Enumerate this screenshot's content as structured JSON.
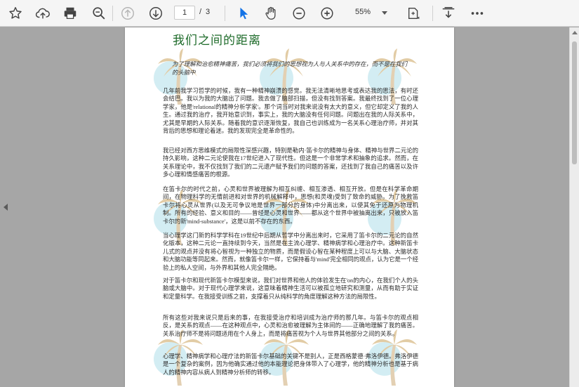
{
  "toolbar": {
    "current_page": "1",
    "page_separator": "/",
    "total_pages": "3",
    "zoom": "55%"
  },
  "document": {
    "title": "我们之间的距离",
    "subtitle": "为了理解和治愈精神痛苦，我们必须将我们的思想视为人与人关系中的存在，而不是在我们的头脑中",
    "paragraphs": [
      "几年前我学习哲学的时候，我有一种精神崩溃的感觉。我无法清晰地思考或表达我的思法，有时还会结巴。我以为我的大脑出了问题。我去做了脑部扫描，但没有找到答案。我最终找到了一位心理学家，他是'relational的精神分析学家'。那个词当时对我来说没有太大的意义，但它却定义了我的人生。通过我的治疗，我开始意识到，事实上，我的大脑没有任何问题。问题出在我的人际关系中，尤其是早期的人际关系。随着我的意识逐渐恢复，我自己也训练成为一名关系心理治疗师，并对其背后的思想和理论着迷。我的发现完全是革命性的。",
      "我已经对西方思维模式的局限性深感兴趣，特别是勒内·笛卡尔的精神与身体、精神与世界二元论的持久影响，这种二元论使我在17世纪进入了现代性。但这是一个非常学术和抽象的追求。然而，在关系理论中，我不仅找到了我们的二元遗产赋予我们的问题的答案，还找到了我自己的痛苦以及许多心理和情感痛苦的根源。",
      "在笛卡尔的时代之前，心灵和世界被理解为相互纠缠、相互渗透、相互开放。但是在科学革命期间，在物理科学的无情前进和对世界的机械解释中，思想(和灵魂)受到了致命的威胁。为了挽救笛卡尔将心灵从世界(以及无可争议地是世界一部分的身体)中分离出来，以使其免于还原为物理机制。所有的经验、意义和目的——曾经是心灵和世界——都从这个世界中被抽离出来，只被放入笛卡尔的新'mind-substance'，这是以前不存在的东西。",
      "当心理学这门新的科学学科在19世纪中后期从哲学中分离出来时，它采用了笛卡尔的二元论的自然化版本，这种二元论一直持续到今天，当然是在主流心理学、精神病学和心理治疗中。这种新笛卡儿式的观点并没有将心智视为一种独立的物质，而是假设心智在某种程度上可以与大脑、大脑状态和大脑功能等同起来。然而，就像笛卡尔一样，它保持着与'mind'完全相同的观点，认为它是一个经验上的私人空间，与外界和其他人完全隔绝。",
      "对于笛卡尔和现代新笛卡尔模型来说，我们对世界和他人的体验发生在'on的内心，在我们个人的头脑或大脑中。对于现代心理学来说，这意味着精神生活可以被孤立地研究和测量，从而有助于实证和定量科学。在我接受训练之前，支撑着只从纯科学的角度理解这种方法的局限性。",
      "所有这些对我来说只是后来的事，在我接受治疗和培训成为治疗师的那几年。与笛卡尔的观点相反，是关系的观点——在这种观点中，心灵和治愈被理解为主体间的——正确地理解了我的痛苦。关系治疗师不是将问题适用在个人身上，而是将痛苦视为个人与世界其他部分之间的关系。",
      "心理学、精神病学和心理疗法的新笛卡尔基础的关键不是别人，正是西格蒙德·弗洛伊德。弗洛伊德是一个复杂的案例，因为他确实通过他的本能理论把身体带入了心理学，他的精神分析也是基于病人的精神内容从病人到精神分析师的转移。"
    ]
  }
}
